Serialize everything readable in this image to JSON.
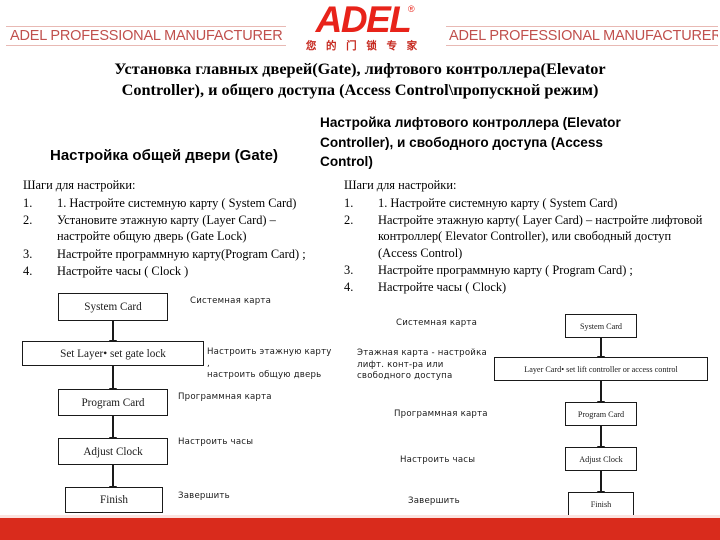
{
  "header": {
    "banner_left": "ADEL PROFESSIONAL MANUFACTURER",
    "banner_right": "ADEL PROFESSIONAL MANUFACTURER",
    "logo_text": "ADEL",
    "logo_registered": "®",
    "logo_tagline_cn": "您 的 门 锁 专 家",
    "brand_red": "#e8231a",
    "banner_text_color": "#c0504d"
  },
  "title": {
    "line1": "Установка главных дверей(Gate), лифтового контроллера(Elevator",
    "line2": "Controller), и общего доступа (Access Control\\пропускной режим)"
  },
  "left_column": {
    "heading": "Настройка общей двери (Gate)",
    "steps_label": "Шаги для настройки:",
    "steps": [
      {
        "num": "1.",
        "text": "1. Настройте системную карту ( System Card)"
      },
      {
        "num": "2.",
        "text": "Установите этажную карту (Layer Card) – настройте общую дверь  (Gate Lock)"
      },
      {
        "num": "3.",
        "text": "Настройте программную карту(Program Card) ;"
      },
      {
        "num": "4.",
        "text": "Настройте часы ( Clock )"
      }
    ]
  },
  "right_column": {
    "heading_line1": "Настройка лифтового контроллера  (Elevator",
    "heading_line2": "Controller), и свободного доступа (Access",
    "heading_line3": "Control)",
    "steps_label": "Шаги для настройки:",
    "steps": [
      {
        "num": "1.",
        "text": "1. Настройте системную карту ( System Card)"
      },
      {
        "num": "2.",
        "text": "Настройте этажную карту( Layer Card) – настройте лифтовой контроллер( Elevator Controller), или свободный доступ (Access Control)"
      },
      {
        "num": "3.",
        "text": "Настройте программную карту ( Program Card) ;"
      },
      {
        "num": "4.",
        "text": "Настройте часы ( Clock)"
      }
    ]
  },
  "left_flow": {
    "box1": "System Card",
    "box2": "Set Layer•  set gate lock",
    "box3": "Program Card",
    "box4": "Adjust Clock",
    "box5": "Finish",
    "annot1": "Системная карта",
    "annot2_line1": "Настроить этажную карту ,",
    "annot2_line2": "настроить общую дверь",
    "annot3": "Программная карта",
    "annot4": "Настроить часы",
    "annot5": "Завершить"
  },
  "right_flow": {
    "box1": "System Card",
    "box2": "Layer Card•  set lift controller or access control",
    "box3": "Program Card",
    "box4": "Adjust Clock",
    "box5": "Finish",
    "annot1": "Системная карта",
    "annot2_line1": "Этажная карта -  настройка",
    "annot2_line2": "лифт. конт-ра или",
    "annot2_line3": "свободного доступа",
    "annot3": "Программная карта",
    "annot4": "Настроить часы",
    "annot5": "Завершить"
  },
  "footer": {
    "color": "#d92b1c"
  }
}
